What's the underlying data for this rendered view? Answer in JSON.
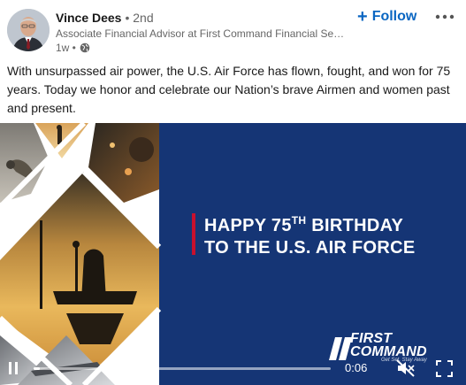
{
  "post": {
    "author": {
      "name": "Vince Dees",
      "degree": "• 2nd",
      "headline": "Associate Financial Advisor at First Command Financial Servi...",
      "timestamp": "1w •",
      "visibility_icon": "globe-icon"
    },
    "actions": {
      "follow_label": "Follow",
      "follow_icon": "plus-icon",
      "more_icon": "more-icon"
    },
    "text": "With unsurpassed air power, the U.S. Air Force has flown, fought, and won for 75 years. Today we honor and celebrate our Nation’s brave Airmen and women past and present."
  },
  "video": {
    "banner": {
      "line1_prefix": "HAPPY 75",
      "line1_sup": "TH",
      "line1_suffix": " BIRTHDAY",
      "line2": "TO THE U.S. AIR FORCE"
    },
    "brand": {
      "line1": "FIRST",
      "line2": "COMMAND",
      "tagline": "Get Set. Stay Away"
    },
    "controls": {
      "time_remaining": "0:06",
      "progress": 0.02,
      "play_state": "playing",
      "muted": true
    },
    "colors": {
      "background": "#153575",
      "accent_red": "#c8102e",
      "link_blue": "#0a66c2"
    }
  }
}
